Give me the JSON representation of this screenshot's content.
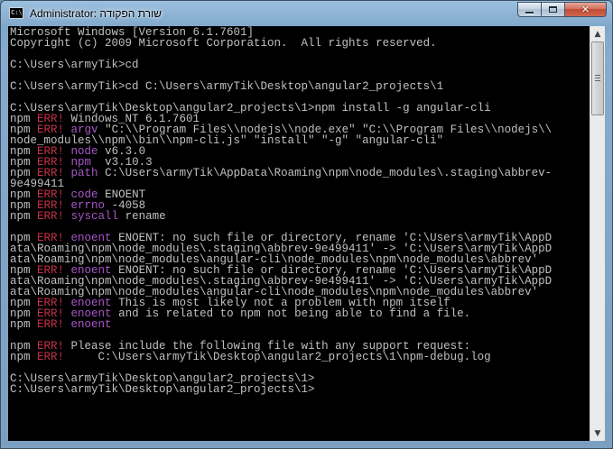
{
  "window": {
    "title": "Administrator: שורת הפקודה",
    "icon": "cmd-icon",
    "icon_text": "C:\\",
    "controls": {
      "minimize": "minimize-icon",
      "maximize": "maximize-icon",
      "close": "close-icon",
      "close_glyph": "✕"
    }
  },
  "colors": {
    "console_bg": "#000000",
    "console_text": "#c0c0c0",
    "err_red": "#c4304a",
    "key_purple": "#a856c8"
  },
  "console": {
    "lines": [
      {
        "segs": [
          {
            "t": "Microsoft Windows [Version 6.1.7601]"
          }
        ]
      },
      {
        "segs": [
          {
            "t": "Copyright (c) 2009 Microsoft Corporation.  All rights reserved."
          }
        ]
      },
      {
        "segs": []
      },
      {
        "segs": [
          {
            "t": "C:\\Users\\armyTik>cd"
          }
        ]
      },
      {
        "segs": []
      },
      {
        "segs": [
          {
            "t": "C:\\Users\\armyTik>cd C:\\Users\\armyTik\\Desktop\\angular2_projects\\1"
          }
        ]
      },
      {
        "segs": []
      },
      {
        "segs": [
          {
            "t": "C:\\Users\\armyTik\\Desktop\\angular2_projects\\1>npm install -g angular-cli"
          }
        ]
      },
      {
        "segs": [
          {
            "t": "npm "
          },
          {
            "t": "ERR!",
            "c": "err"
          },
          {
            "t": " Windows_NT 6.1.7601"
          }
        ]
      },
      {
        "segs": [
          {
            "t": "npm "
          },
          {
            "t": "ERR!",
            "c": "err"
          },
          {
            "t": " "
          },
          {
            "t": "argv",
            "c": "key"
          },
          {
            "t": " \"C:\\\\Program Files\\\\nodejs\\\\node.exe\" \"C:\\\\Program Files\\\\nodejs\\\\"
          }
        ]
      },
      {
        "segs": [
          {
            "t": "node_modules\\\\npm\\\\bin\\\\npm-cli.js\" \"install\" \"-g\" \"angular-cli\""
          }
        ]
      },
      {
        "segs": [
          {
            "t": "npm "
          },
          {
            "t": "ERR!",
            "c": "err"
          },
          {
            "t": " "
          },
          {
            "t": "node",
            "c": "key"
          },
          {
            "t": " v6.3.0"
          }
        ]
      },
      {
        "segs": [
          {
            "t": "npm "
          },
          {
            "t": "ERR!",
            "c": "err"
          },
          {
            "t": " "
          },
          {
            "t": "npm",
            "c": "key"
          },
          {
            "t": "  v3.10.3"
          }
        ]
      },
      {
        "segs": [
          {
            "t": "npm "
          },
          {
            "t": "ERR!",
            "c": "err"
          },
          {
            "t": " "
          },
          {
            "t": "path",
            "c": "key"
          },
          {
            "t": " C:\\Users\\armyTik\\AppData\\Roaming\\npm\\node_modules\\.staging\\abbrev-"
          }
        ]
      },
      {
        "segs": [
          {
            "t": "9e499411"
          }
        ]
      },
      {
        "segs": [
          {
            "t": "npm "
          },
          {
            "t": "ERR!",
            "c": "err"
          },
          {
            "t": " "
          },
          {
            "t": "code",
            "c": "key"
          },
          {
            "t": " ENOENT"
          }
        ]
      },
      {
        "segs": [
          {
            "t": "npm "
          },
          {
            "t": "ERR!",
            "c": "err"
          },
          {
            "t": " "
          },
          {
            "t": "errno",
            "c": "key"
          },
          {
            "t": " -4058"
          }
        ]
      },
      {
        "segs": [
          {
            "t": "npm "
          },
          {
            "t": "ERR!",
            "c": "err"
          },
          {
            "t": " "
          },
          {
            "t": "syscall",
            "c": "key"
          },
          {
            "t": " rename"
          }
        ]
      },
      {
        "segs": []
      },
      {
        "segs": [
          {
            "t": "npm "
          },
          {
            "t": "ERR!",
            "c": "err"
          },
          {
            "t": " "
          },
          {
            "t": "enoent",
            "c": "key"
          },
          {
            "t": " ENOENT: no such file or directory, rename 'C:\\Users\\armyTik\\AppD"
          }
        ]
      },
      {
        "segs": [
          {
            "t": "ata\\Roaming\\npm\\node_modules\\.staging\\abbrev-9e499411' -> 'C:\\Users\\armyTik\\AppD"
          }
        ]
      },
      {
        "segs": [
          {
            "t": "ata\\Roaming\\npm\\node_modules\\angular-cli\\node_modules\\npm\\node_modules\\abbrev'"
          }
        ]
      },
      {
        "segs": [
          {
            "t": "npm "
          },
          {
            "t": "ERR!",
            "c": "err"
          },
          {
            "t": " "
          },
          {
            "t": "enoent",
            "c": "key"
          },
          {
            "t": " ENOENT: no such file or directory, rename 'C:\\Users\\armyTik\\AppD"
          }
        ]
      },
      {
        "segs": [
          {
            "t": "ata\\Roaming\\npm\\node_modules\\.staging\\abbrev-9e499411' -> 'C:\\Users\\armyTik\\AppD"
          }
        ]
      },
      {
        "segs": [
          {
            "t": "ata\\Roaming\\npm\\node_modules\\angular-cli\\node_modules\\npm\\node_modules\\abbrev'"
          }
        ]
      },
      {
        "segs": [
          {
            "t": "npm "
          },
          {
            "t": "ERR!",
            "c": "err"
          },
          {
            "t": " "
          },
          {
            "t": "enoent",
            "c": "key"
          },
          {
            "t": " This is most likely not a problem with npm itself"
          }
        ]
      },
      {
        "segs": [
          {
            "t": "npm "
          },
          {
            "t": "ERR!",
            "c": "err"
          },
          {
            "t": " "
          },
          {
            "t": "enoent",
            "c": "key"
          },
          {
            "t": " and is related to npm not being able to find a file."
          }
        ]
      },
      {
        "segs": [
          {
            "t": "npm "
          },
          {
            "t": "ERR!",
            "c": "err"
          },
          {
            "t": " "
          },
          {
            "t": "enoent",
            "c": "key"
          }
        ]
      },
      {
        "segs": []
      },
      {
        "segs": [
          {
            "t": "npm "
          },
          {
            "t": "ERR!",
            "c": "err"
          },
          {
            "t": " Please include the following file with any support request:"
          }
        ]
      },
      {
        "segs": [
          {
            "t": "npm "
          },
          {
            "t": "ERR!",
            "c": "err"
          },
          {
            "t": "     C:\\Users\\armyTik\\Desktop\\angular2_projects\\1\\npm-debug.log"
          }
        ]
      },
      {
        "segs": []
      },
      {
        "segs": [
          {
            "t": "C:\\Users\\armyTik\\Desktop\\angular2_projects\\1>"
          }
        ]
      },
      {
        "segs": [
          {
            "t": "C:\\Users\\armyTik\\Desktop\\angular2_projects\\1>"
          }
        ]
      }
    ]
  },
  "scrollbar": {
    "up_glyph": "▲",
    "down_glyph": "▼",
    "up_icon": "scroll-up-arrow-icon",
    "down_icon": "scroll-down-arrow-icon",
    "thumb_position": "top"
  }
}
